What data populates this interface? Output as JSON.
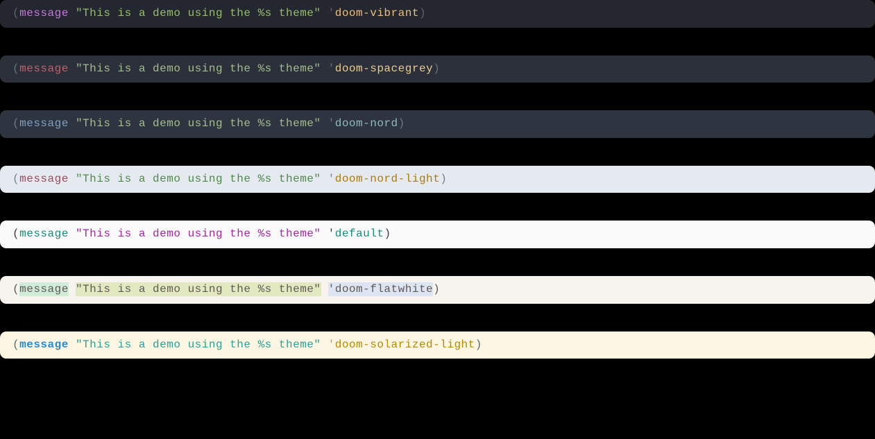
{
  "themes": [
    {
      "id": "vibrant",
      "bg_class": "theme-vibrant",
      "paren_open": "(",
      "paren_close": ")",
      "message": "message",
      "string": "\"This is a demo using the %s theme\"",
      "quote": "'",
      "symbol": "doom-vibrant",
      "classes": {
        "paren": "vibrant-paren",
        "message": "vibrant-message",
        "string": "vibrant-string",
        "quote": "vibrant-quote",
        "symbol": "vibrant-symbol"
      }
    },
    {
      "id": "spacegrey",
      "bg_class": "theme-spacegrey",
      "paren_open": "(",
      "paren_close": ")",
      "message": "message",
      "string": "\"This is a demo using the %s theme\"",
      "quote": "'",
      "symbol": "doom-spacegrey",
      "classes": {
        "paren": "spacegrey-paren",
        "message": "spacegrey-message",
        "string": "spacegrey-string",
        "quote": "spacegrey-quote",
        "symbol": "spacegrey-symbol"
      }
    },
    {
      "id": "nord",
      "bg_class": "theme-nord",
      "paren_open": "(",
      "paren_close": ")",
      "message": "message",
      "string": "\"This is a demo using the %s theme\"",
      "quote": "'",
      "symbol": "doom-nord",
      "classes": {
        "paren": "nord-paren",
        "message": "nord-message",
        "string": "nord-string",
        "quote": "nord-quote",
        "symbol": "nord-symbol"
      }
    },
    {
      "id": "nord-light",
      "bg_class": "theme-nord-light",
      "paren_open": "(",
      "paren_close": ")",
      "message": "message",
      "string": "\"This is a demo using the %s theme\"",
      "quote": "'",
      "symbol": "doom-nord-light",
      "classes": {
        "paren": "nord-light-paren",
        "message": "nord-light-message",
        "string": "nord-light-string",
        "quote": "nord-light-quote",
        "symbol": "nord-light-symbol"
      }
    },
    {
      "id": "default",
      "bg_class": "theme-default",
      "paren_open": "(",
      "paren_close": ")",
      "message": "message",
      "string": "\"This is a demo using the %s theme\"",
      "quote": "'",
      "symbol": "default",
      "classes": {
        "paren": "default-paren",
        "message": "default-message",
        "string": "default-string",
        "quote": "default-quote",
        "symbol": "default-symbol"
      }
    },
    {
      "id": "flatwhite",
      "bg_class": "theme-flatwhite",
      "paren_open": "(",
      "paren_close": ")",
      "message": "message",
      "string": "\"This is a demo using the %s theme\"",
      "quote": "'",
      "symbol": "doom-flatwhite",
      "classes": {
        "paren": "flatwhite-paren",
        "message": "flatwhite-message",
        "string": "flatwhite-string",
        "quote": "flatwhite-quote",
        "symbol": "flatwhite-symbol"
      }
    },
    {
      "id": "solarized-light",
      "bg_class": "theme-solarized-light",
      "paren_open": "(",
      "paren_close": ")",
      "message": "message",
      "string": "\"This is a demo using the %s theme\"",
      "quote": "'",
      "symbol": "doom-solarized-light",
      "classes": {
        "paren": "solarized-light-paren",
        "message": "solarized-light-message",
        "string": "solarized-light-string",
        "quote": "solarized-light-quote",
        "symbol": "solarized-light-symbol"
      }
    }
  ]
}
